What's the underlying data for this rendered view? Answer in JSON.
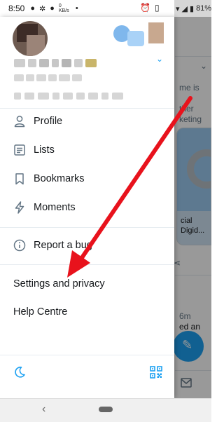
{
  "status_bar": {
    "time": "8:50",
    "speed": "0 KB/s",
    "battery": "81%"
  },
  "drawer": {
    "menu": [
      {
        "icon": "person-icon",
        "label": "Profile"
      },
      {
        "icon": "lists-icon",
        "label": "Lists"
      },
      {
        "icon": "bookmark-icon",
        "label": "Bookmarks"
      },
      {
        "icon": "lightning-icon",
        "label": "Moments"
      },
      {
        "icon": "info-icon",
        "label": "Report a bug"
      }
    ],
    "settings_label": "Settings and privacy",
    "help_label": "Help Centre"
  },
  "background": {
    "snippets": [
      "me is",
      "ther",
      "keting",
      "cial",
      "Digid...",
      "6m",
      "ed an"
    ]
  },
  "colors": {
    "accent": "#1da1f2",
    "arrow": "#e8121c"
  }
}
